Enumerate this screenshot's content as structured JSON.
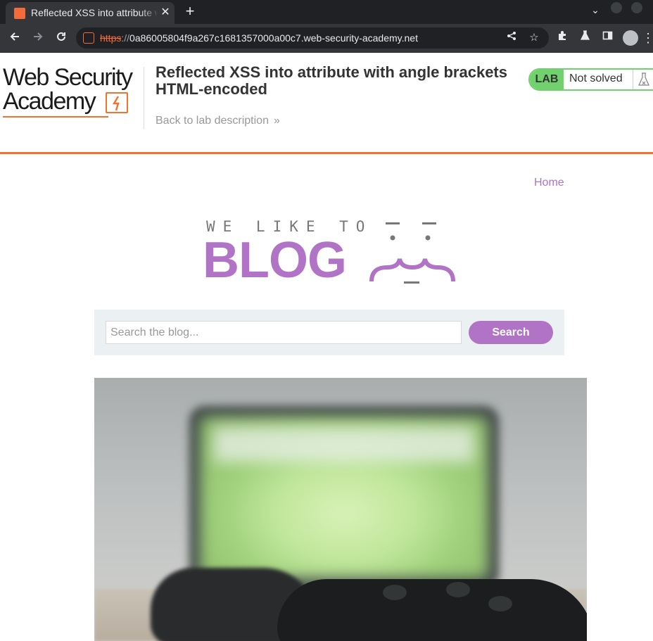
{
  "browser": {
    "tab_title": "Reflected XSS into attribute with angle brackets HTML-encoded",
    "tab_close": "✕",
    "new_tab": "+",
    "url_scheme": "https",
    "url_separator": "://",
    "url_host": "0a86005804f9a267c1681357000a00c7.web-security-academy.net",
    "icons": [
      "back-icon",
      "forward-icon",
      "reload-icon",
      "site-info-icon",
      "share-icon",
      "bookmark-star-icon",
      "extensions-icon",
      "labs-flask-icon",
      "side-panel-icon",
      "profile-icon",
      "menu-icon"
    ]
  },
  "academy": {
    "logo_line1": "Web Security",
    "logo_line2": "Academy",
    "lab_title": "Reflected XSS into attribute with angle brackets HTML-encoded",
    "back_link": "Back to lab description",
    "back_chevrons": "»",
    "lab_badge": "LAB",
    "lab_status": "Not solved"
  },
  "blog": {
    "nav_home": "Home",
    "tagline": "WE LIKE TO",
    "wordmark": "BLOG",
    "search_placeholder": "Search the blog...",
    "search_button": "Search"
  },
  "colors": {
    "accent_orange": "#f0742e",
    "lab_green": "#70d16d",
    "blog_purple": "#b073c5",
    "search_panel_bg": "#ebf0f2"
  }
}
